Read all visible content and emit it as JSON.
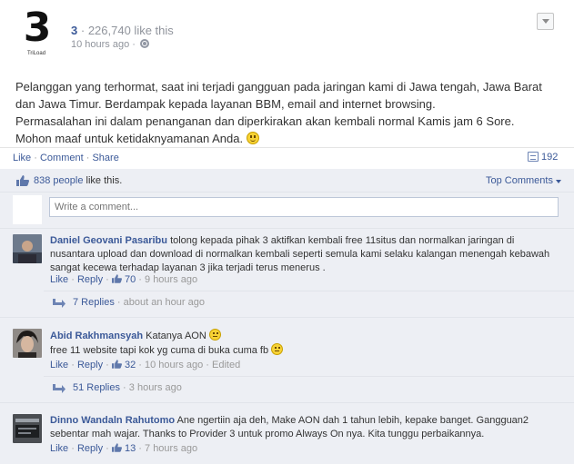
{
  "page": {
    "logo_text": "3",
    "logo_sub": "TriLoad",
    "name": "3",
    "likes_count": "226,740 like this",
    "time": "10 hours ago"
  },
  "post": {
    "line1": "Pelanggan yang terhormat, saat ini terjadi gangguan pada jaringan kami di Jawa tengah, Jawa Barat dan Jawa Timur. Berdampak kepada layanan BBM, email and internet browsing.",
    "line2": "Permasalahan ini dalam penanganan dan diperkirakan akan kembali normal Kamis jam 6 Sore.",
    "line3": "Mohon maaf untuk ketidaknyamanan Anda."
  },
  "actions": {
    "like": "Like",
    "comment": "Comment",
    "share": "Share",
    "sep": "·",
    "share_count": "192"
  },
  "likes_row": {
    "count_link": "838 people",
    "suffix": "like this.",
    "top_comments": "Top Comments"
  },
  "compose": {
    "placeholder": "Write a comment..."
  },
  "comments": [
    {
      "name": "Daniel Geovani Pasaribu",
      "text": "tolong kepada pihak 3 aktifkan kembali free 11situs dan normalkan jaringan di nusantara upload dan download di normalkan kembali seperti semula kami selaku kalangan menengah kebawah sangat kecewa terhadap layanan 3 jika terjadi terus menerus .",
      "like": "Like",
      "reply": "Reply",
      "likes": "70",
      "time": "9 hours ago",
      "replies": "7 Replies",
      "replies_time": "about an hour ago"
    },
    {
      "name": "Abid Rakhmansyah",
      "text_a": "Katanya AON",
      "text_b": "free 11 website tapi kok yg cuma di buka cuma fb",
      "like": "Like",
      "reply": "Reply",
      "likes": "32",
      "time": "10 hours ago",
      "edited": "Edited",
      "replies": "51 Replies",
      "replies_time": "3 hours ago"
    },
    {
      "name": "Dinno Wandaln Rahutomo",
      "text": "Ane ngertiin aja deh, Make AON dah 1 tahun lebih, kepake banget. Gangguan2 sebentar mah wajar. Thanks to Provider 3 untuk promo Always On nya. Kita tunggu perbaikannya.",
      "like": "Like",
      "reply": "Reply",
      "likes": "13",
      "time": "7 hours ago"
    }
  ],
  "colors": {
    "link": "#3b5998",
    "comments_bg": "#edeff4",
    "muted": "#90949c"
  }
}
